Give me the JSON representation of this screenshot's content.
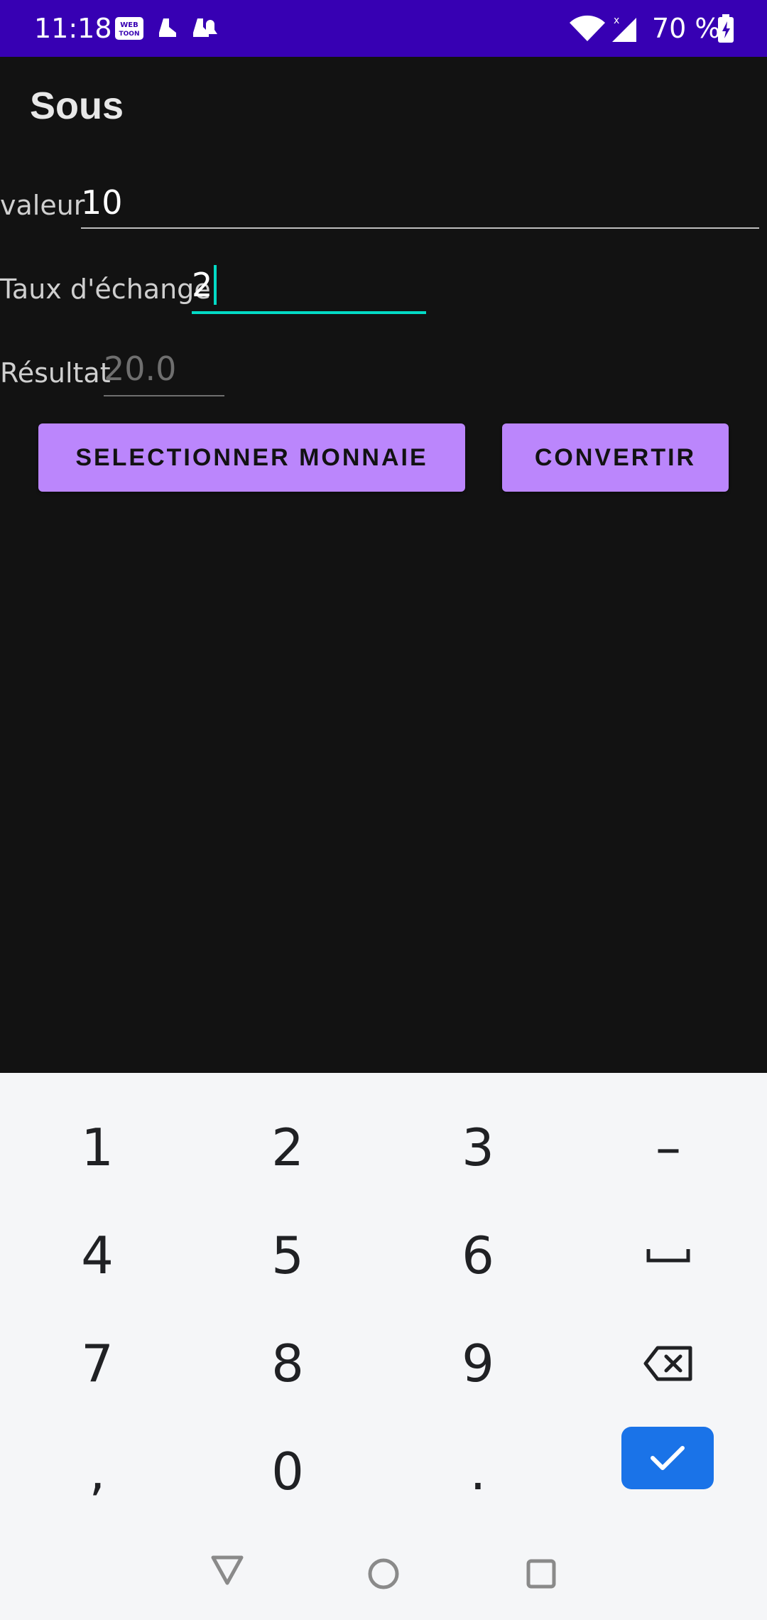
{
  "status_bar": {
    "time": "11:18",
    "battery": "70 %",
    "notification_icons": [
      "webtoon-icon",
      "app-notification-icon",
      "app-notification-icon"
    ]
  },
  "app": {
    "title": "Sous"
  },
  "form": {
    "valeur_label": "valeur",
    "valeur_value": "10",
    "taux_label": "Taux d'échange",
    "taux_value": "2",
    "resultat_label": "Résultat",
    "resultat_value": "20.0"
  },
  "buttons": {
    "select_currency": "SELECTIONNER MONNAIE",
    "convert": "CONVERTIR"
  },
  "keyboard": {
    "rows": [
      [
        "1",
        "2",
        "3",
        "–"
      ],
      [
        "4",
        "5",
        "6",
        "␣"
      ],
      [
        "7",
        "8",
        "9",
        "⌫"
      ],
      [
        ",",
        "0",
        ".",
        "✓"
      ]
    ]
  },
  "colors": {
    "status_bar": "#3700B3",
    "background": "#121212",
    "button": "#BB86FC",
    "accent": "#03DAC5",
    "keyboard_done": "#1a73e8"
  }
}
